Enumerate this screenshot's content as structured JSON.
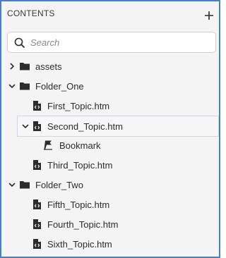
{
  "panel": {
    "title": "CONTENTS",
    "add_icon": "plus-icon"
  },
  "search": {
    "placeholder": "Search",
    "value": "",
    "icon": "search-icon"
  },
  "tree": [
    {
      "label": "assets",
      "type": "folder",
      "expanded": false,
      "level": 0
    },
    {
      "label": "Folder_One",
      "type": "folder",
      "expanded": true,
      "level": 0
    },
    {
      "label": "First_Topic.htm",
      "type": "topic",
      "level": 1
    },
    {
      "label": "Second_Topic.htm",
      "type": "topic",
      "expanded": true,
      "selected": true,
      "level": 1
    },
    {
      "label": "Bookmark",
      "type": "bookmark",
      "level": 2
    },
    {
      "label": "Third_Topic.htm",
      "type": "topic",
      "level": 1
    },
    {
      "label": "Folder_Two",
      "type": "folder",
      "expanded": true,
      "level": 0
    },
    {
      "label": "Fifth_Topic.htm",
      "type": "topic",
      "level": 1
    },
    {
      "label": "Fourth_Topic.htm",
      "type": "topic",
      "level": 1
    },
    {
      "label": "Sixth_Topic.htm",
      "type": "topic",
      "level": 1
    }
  ],
  "colors": {
    "border_accent": "#4a7fc1",
    "panel_bg": "#f4f4f4",
    "icon": "#2c2c2c"
  }
}
